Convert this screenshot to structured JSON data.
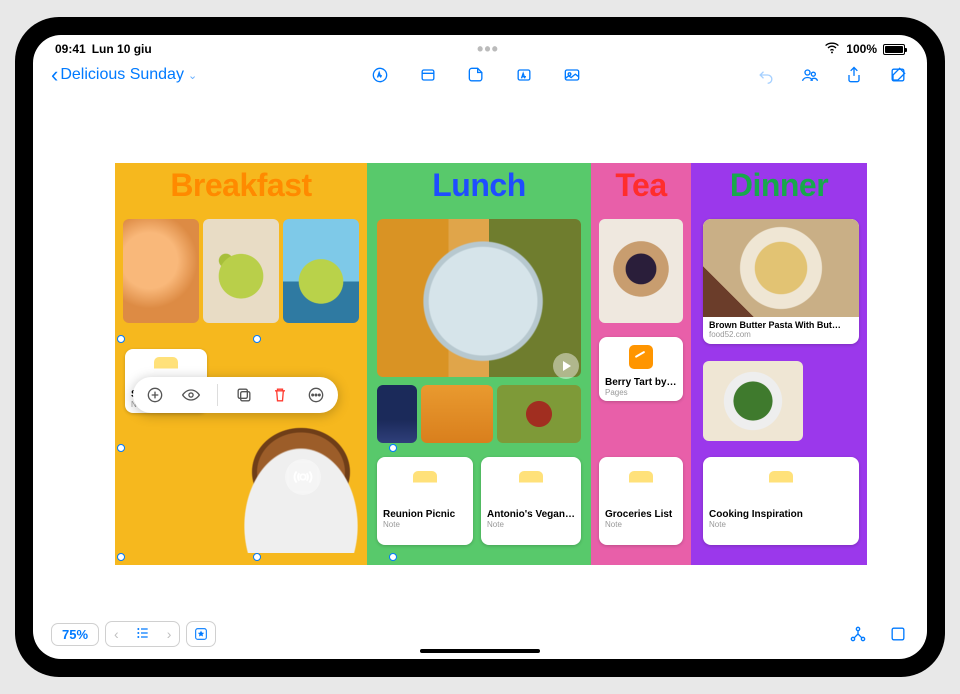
{
  "status": {
    "time": "09:41",
    "date": "Lun 10 giu",
    "battery_pct": "100%"
  },
  "toolbar": {
    "back_title": "Delicious Sunday"
  },
  "board": {
    "columns": [
      {
        "title": "Breakfast"
      },
      {
        "title": "Lunch"
      },
      {
        "title": "Tea"
      },
      {
        "title": "Dinner"
      }
    ]
  },
  "cards": {
    "summer_party": {
      "title": "Summer Party",
      "subtitle": "Note"
    },
    "reunion": {
      "title": "Reunion Picnic",
      "subtitle": "Note"
    },
    "tacos": {
      "title": "Antonio's Vegan Tacos",
      "subtitle": "Note"
    },
    "groceries": {
      "title": "Groceries List",
      "subtitle": "Note"
    },
    "cooking": {
      "title": "Cooking Inspiration",
      "subtitle": "Note"
    },
    "berry_tart": {
      "title": "Berry Tart by Olivia",
      "subtitle": "Pages"
    },
    "pasta_link": {
      "title": "Brown Butter Pasta With But…",
      "subtitle": "food52.com"
    }
  },
  "zoom": {
    "level": "75%"
  }
}
